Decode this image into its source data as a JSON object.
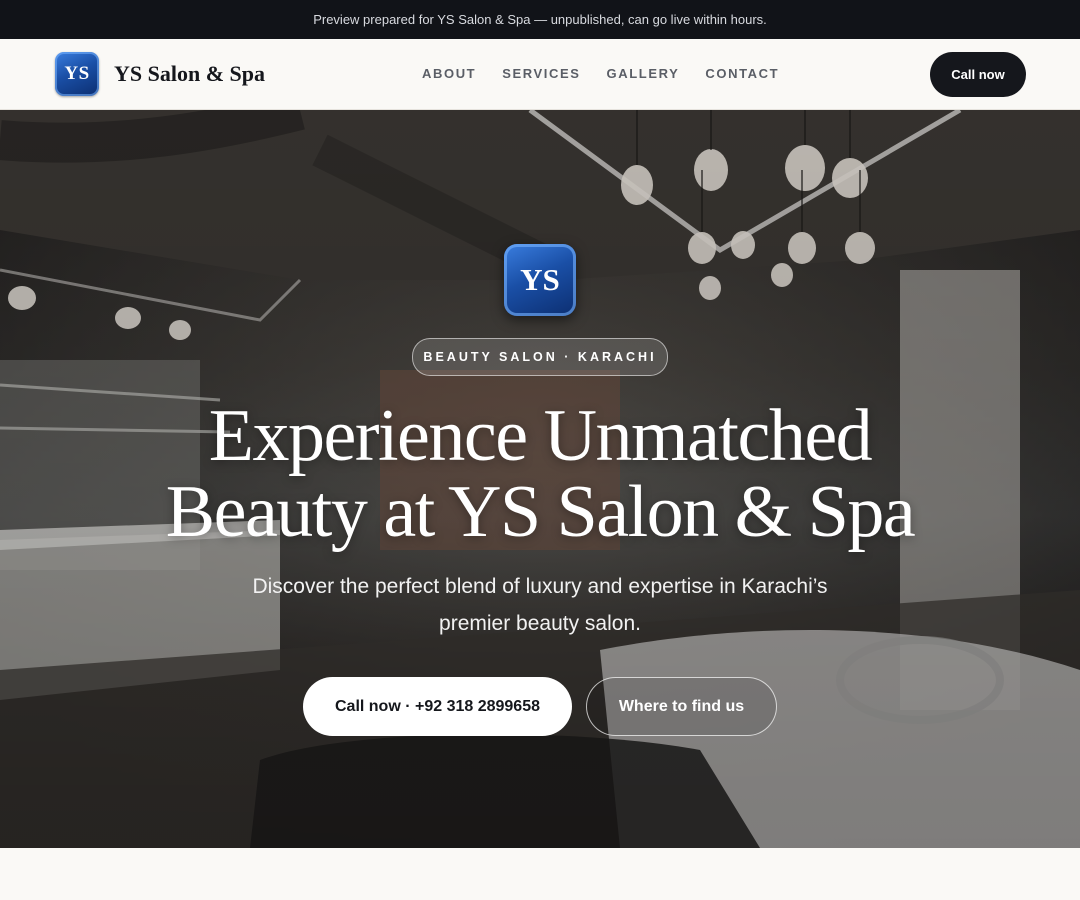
{
  "preview_bar": {
    "text": "Preview prepared for YS Salon & Spa — unpublished, can go live within hours."
  },
  "header": {
    "logo_initials": "YS",
    "brand_name": "YS Salon & Spa",
    "nav": [
      "ABOUT",
      "SERVICES",
      "GALLERY",
      "CONTACT"
    ],
    "cta_label": "Call now"
  },
  "hero": {
    "logo_initials": "YS",
    "tagline": "BEAUTY SALON · KARACHI",
    "title_line1": "Experience Unmatched",
    "title_line2": "Beauty at YS Salon & Spa",
    "subtitle": "Discover the perfect blend of luxury and expertise in Karachi’s premier beauty salon.",
    "primary_button": "Call now · +92 318 2899658",
    "secondary_button": "Where to find us"
  },
  "colors": {
    "dark": "#15171c",
    "preview_bar_bg": "#111318",
    "logo_blue": "#1a4fa6",
    "page_bg": "#faf9f6"
  }
}
